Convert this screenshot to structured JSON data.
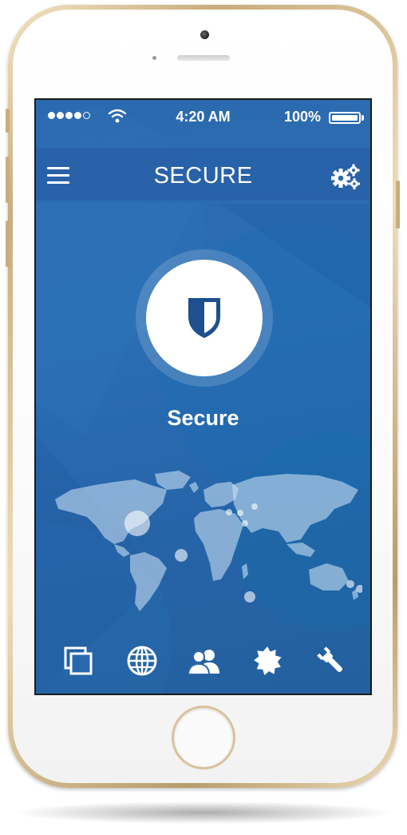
{
  "status_bar": {
    "time": "4:20 AM",
    "battery_percent": "100%",
    "battery_level": 1.0,
    "signal_bars_filled": 4,
    "signal_bars_total": 5
  },
  "nav": {
    "title": "SECURE",
    "menu_icon": "hamburger-menu-icon",
    "settings_icon": "gears-icon"
  },
  "status": {
    "label": "Secure",
    "icon": "shield-icon"
  },
  "tabs": [
    {
      "id": "windows",
      "icon": "windows-icon"
    },
    {
      "id": "globe",
      "icon": "globe-icon"
    },
    {
      "id": "users",
      "icon": "users-icon"
    },
    {
      "id": "badge",
      "icon": "badge-icon"
    },
    {
      "id": "tools",
      "icon": "wrench-icon"
    }
  ],
  "colors": {
    "screen_background": "#2a6db3",
    "shield": "#1e4f8f",
    "text": "#ffffff",
    "phone_frame": "#d9c29b"
  }
}
